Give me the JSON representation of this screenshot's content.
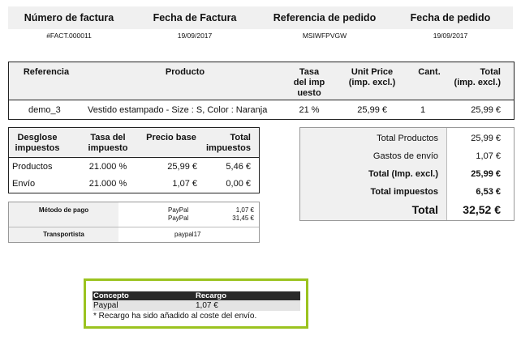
{
  "header": {
    "labels": [
      "Número de factura",
      "Fecha de Factura",
      "Referencia de pedido",
      "Fecha de pedido"
    ],
    "values": [
      "#FACT.000011",
      "19/09/2017",
      "MSIWFPVGW",
      "19/09/2017"
    ]
  },
  "products": {
    "headers": {
      "reference": "Referencia",
      "product": "Producto",
      "tax_rate": "Tasa del imp uesto",
      "unit_price": "Unit Price (impl. excl.)",
      "qty": "Cant.",
      "total": "Total (impl. excl.)"
    },
    "rows": [
      {
        "reference": "demo_3",
        "product": "Vestido estampado - Size : S, Color : Naranja",
        "tax_rate": "21 %",
        "unit_price": "25,99 €",
        "qty": "1",
        "total": "25,99 €"
      }
    ]
  },
  "tax_breakdown": {
    "headers": {
      "desglose": "Desglose impuestos",
      "tasa": "Tasa del impuesto",
      "base": "Precio base",
      "total": "Total impuestos"
    },
    "rows": [
      {
        "label": "Productos",
        "rate": "21.000 %",
        "base": "25,99 €",
        "total": "5,46 €"
      },
      {
        "label": "Envío",
        "rate": "21.000 %",
        "base": "1,07 €",
        "total": "0,00 €"
      }
    ]
  },
  "payment": {
    "method_label": "Método de pago",
    "methods": [
      {
        "name": "PayPal",
        "amount": "1,07 €"
      },
      {
        "name": "PayPal",
        "amount": "31,45 €"
      }
    ],
    "carrier_label": "Transportista",
    "carrier_value": "paypal17"
  },
  "totals": [
    {
      "label": "Total Productos",
      "value": "25,99 €",
      "bold": false
    },
    {
      "label": "Gastos de envío",
      "value": "1,07 €",
      "bold": false
    },
    {
      "label": "Total (Imp. excl.)",
      "value": "25,99 €",
      "bold": true
    },
    {
      "label": "Total impuestos",
      "value": "6,53 €",
      "bold": true
    },
    {
      "label": "Total",
      "value": "32,52 €",
      "bold": true
    }
  ],
  "surcharge": {
    "concept_label": "Concepto",
    "surcharge_label": "Recargo",
    "row_concept": "Paypal",
    "row_value": "1,07 €",
    "note": "* Recargo ha sido añadido al coste del envío."
  },
  "colors": {
    "accent_border": "#9bc31f",
    "surcharge_header_bg": "#2a2a2a"
  }
}
